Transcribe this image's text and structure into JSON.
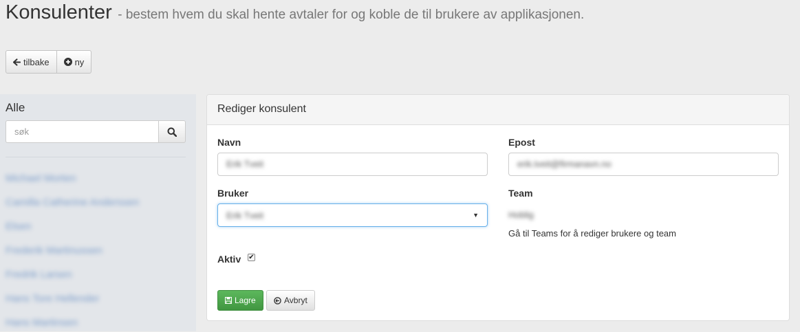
{
  "header": {
    "title": "Konsulenter",
    "subtitle": "- bestem hvem du skal hente avtaler for og koble de til brukere av applikasjonen."
  },
  "toolbar": {
    "back_label": "tilbake",
    "back_icon": "arrow-left-icon",
    "new_label": "ny",
    "new_icon": "plus-circle-icon"
  },
  "sidebar": {
    "heading": "Alle",
    "search": {
      "placeholder": "søk",
      "value": "",
      "icon": "search-icon"
    },
    "items": [
      {
        "label": "Michael Morten"
      },
      {
        "label": "Camilla Catherine Anderssen"
      },
      {
        "label": "Elsen"
      },
      {
        "label": "Frederik Martinussen"
      },
      {
        "label": "Fredrik Larsen"
      },
      {
        "label": "Hans Tore Hellender"
      },
      {
        "label": "Hans Martinsen"
      }
    ]
  },
  "panel": {
    "title": "Rediger konsulent",
    "fields": {
      "name_label": "Navn",
      "name_value": "Erik Tveit",
      "email_label": "Epost",
      "email_value": "erik.tveit@firmanavn.no",
      "user_label": "Bruker",
      "user_value": "Erik Tveit",
      "team_label": "Team",
      "team_value": "Hoblig",
      "team_help": "Gå til Teams for å rediger brukere og team",
      "active_label": "Aktiv",
      "active_checked": true
    },
    "actions": {
      "save_label": "Lagre",
      "save_icon": "floppy-disk-icon",
      "cancel_label": "Avbryt",
      "cancel_icon": "circle-arrow-left-icon"
    }
  },
  "colors": {
    "background": "#ececec",
    "sidebar": "#e3e6ea",
    "success": "#5cb85c",
    "link": "#6a8fc4",
    "focus": "#66afe9"
  }
}
